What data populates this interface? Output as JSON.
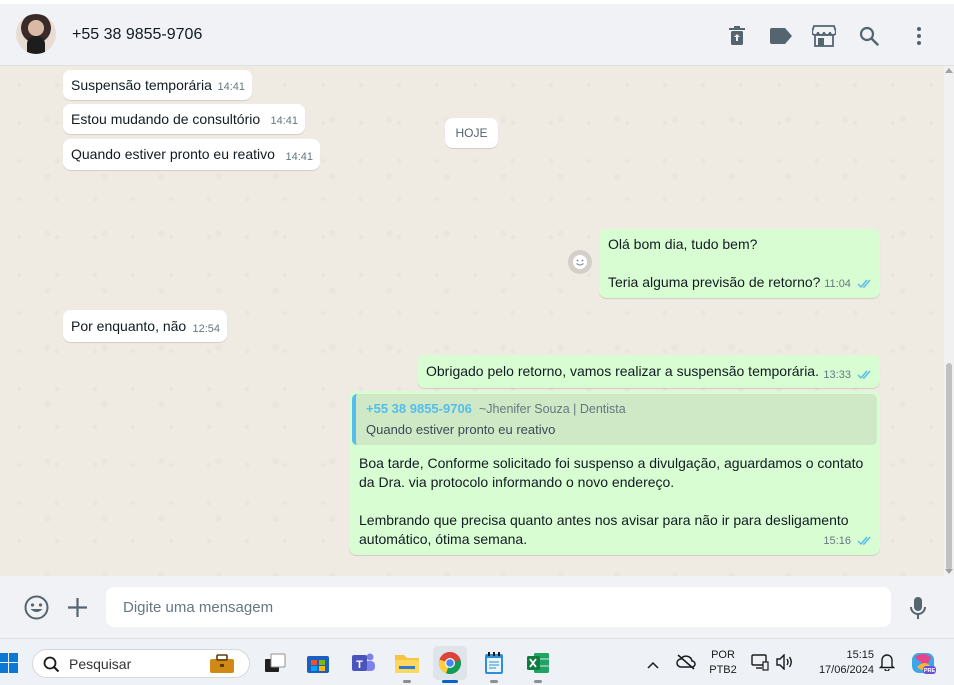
{
  "header": {
    "contact_name": "+55 38 9855-9706",
    "icons": [
      "trash-icon",
      "label-icon",
      "store-icon",
      "search-icon",
      "menu-icon"
    ]
  },
  "messages": [
    {
      "direction": "in",
      "text": "Suspensão temporária",
      "time": "14:41"
    },
    {
      "direction": "in",
      "text": "Estou mudando de consultório",
      "time": "14:41"
    },
    {
      "direction": "in",
      "text": "Quando estiver pronto eu reativo",
      "time": "14:41"
    },
    {
      "direction": "out",
      "lines": [
        "Olá bom dia, tudo bem?",
        "",
        "Teria alguma previsão de retorno?"
      ],
      "time": "11:04",
      "status": "read"
    },
    {
      "direction": "in",
      "text": "Por enquanto, não",
      "time": "12:54"
    },
    {
      "direction": "out",
      "text": "Obrigado pelo retorno, vamos realizar a suspensão temporária.",
      "time": "13:33",
      "status": "read"
    },
    {
      "direction": "out",
      "quote": {
        "author": "+55 38 9855-9706",
        "alt_name": "~Jhenifer Souza | Dentista",
        "text": "Quando estiver pronto eu reativo"
      },
      "lines": [
        "Boa tarde, Conforme solicitado foi suspenso a divulgação, aguardamos o contato",
        "da Dra. via protocolo informando o novo endereço.",
        "",
        "Lembrando que precisa quanto antes nos avisar para não ir para desligamento",
        "automático, ótima semana."
      ],
      "time": "15:16",
      "status": "read"
    }
  ],
  "day_divider": "HOJE",
  "composer": {
    "placeholder": "Digite uma mensagem"
  },
  "taskbar": {
    "search_label": "Pesquisar",
    "language": "POR",
    "keyboard": "PTB2",
    "time": "15:15",
    "date": "17/06/2024"
  },
  "colors": {
    "incoming": "#ffffff",
    "outgoing": "#d9fdd3",
    "read_ticks": "#53bdeb",
    "header_bg": "#f0f2f5",
    "chat_bg": "#efeae2"
  }
}
